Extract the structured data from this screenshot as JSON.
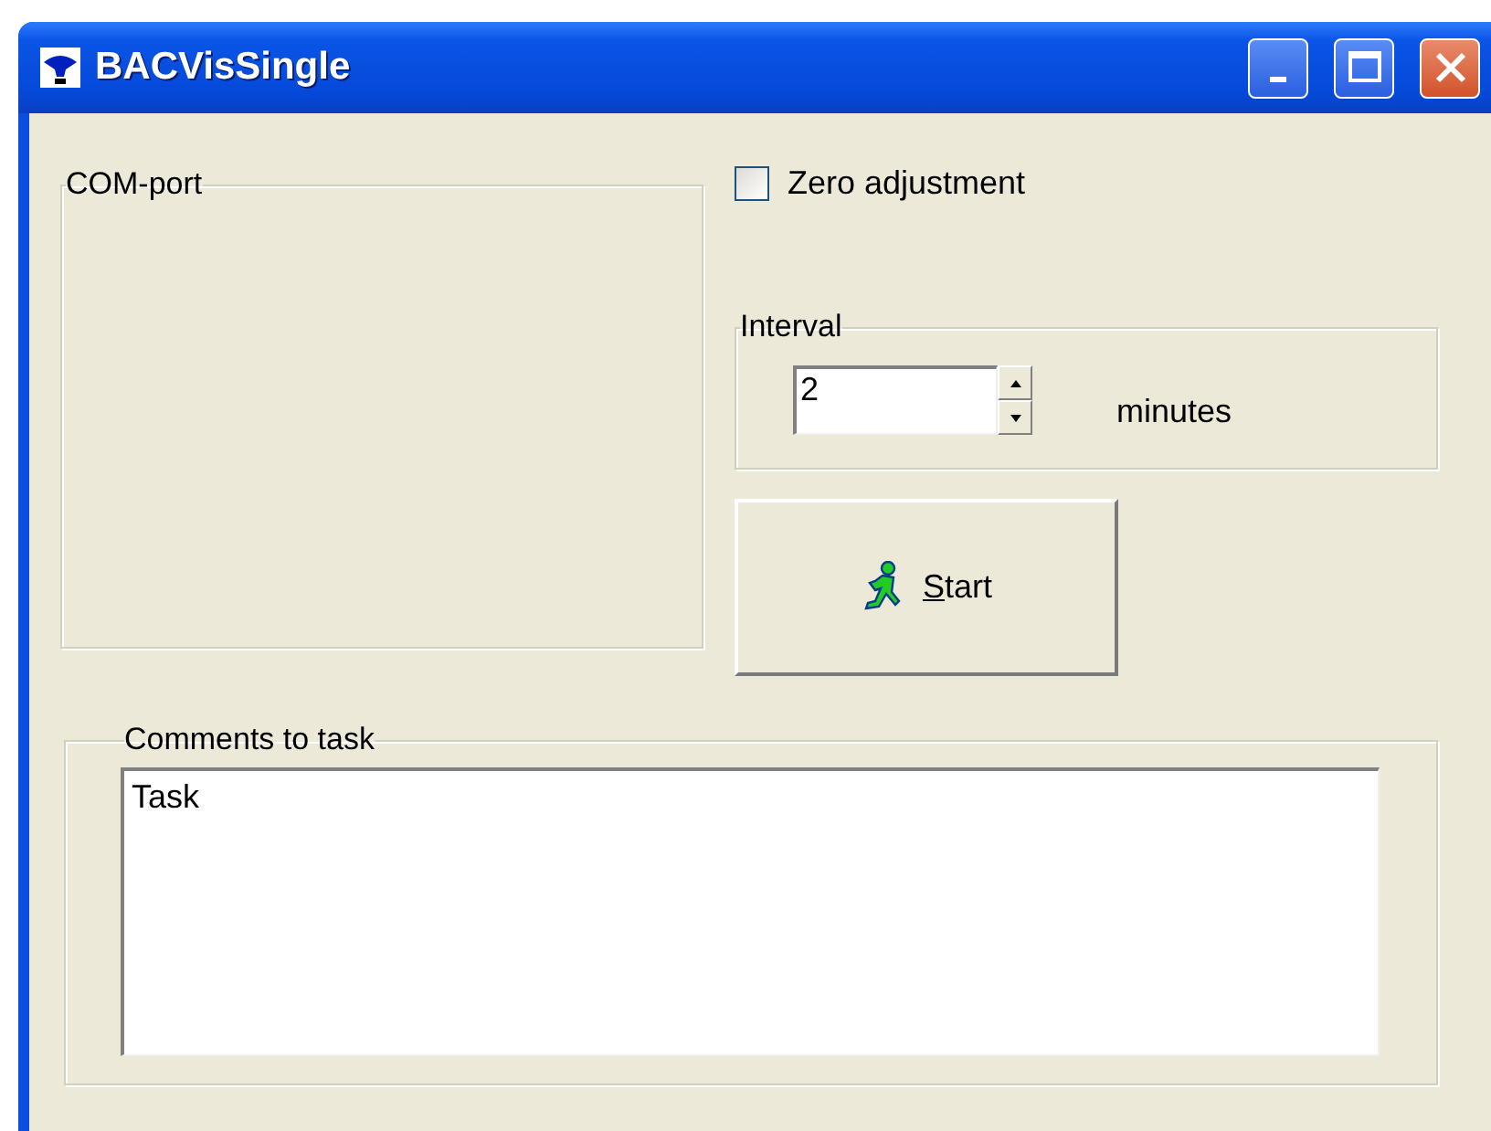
{
  "window": {
    "title": "BACVisSingle"
  },
  "com_port": {
    "label": "COM-port"
  },
  "zero_adjustment": {
    "label": "Zero adjustment",
    "checked": false
  },
  "interval": {
    "label": "Interval",
    "value": "2",
    "unit": "minutes"
  },
  "start_button": {
    "label": "Start"
  },
  "comments": {
    "label": "Comments to task",
    "value": "Task"
  }
}
